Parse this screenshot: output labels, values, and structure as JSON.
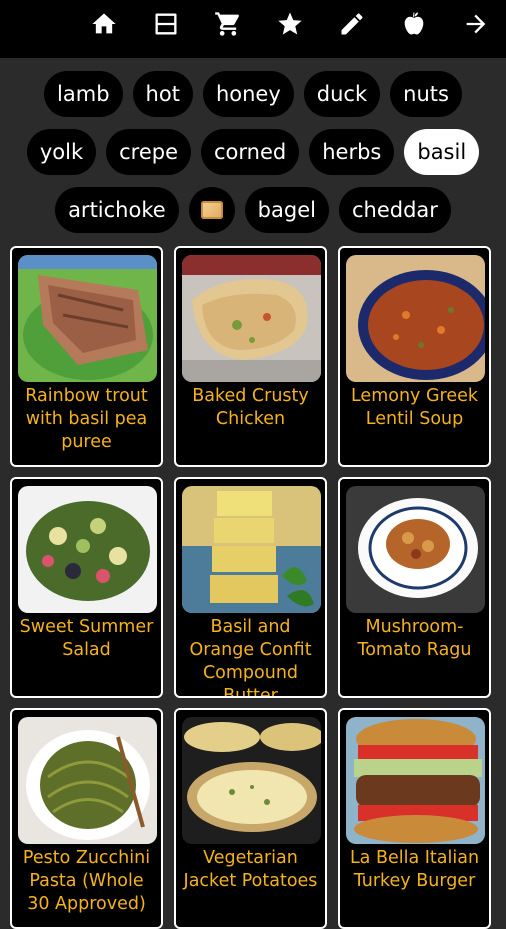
{
  "nav": {
    "icons": [
      "home-icon",
      "view-list-icon",
      "shopping-cart-icon",
      "star-icon",
      "pencil-icon",
      "apple-icon",
      "arrow-right-icon"
    ]
  },
  "filters": {
    "rows": [
      [
        "lamb",
        "hot",
        "honey",
        "duck",
        "nuts"
      ],
      [
        "yolk",
        "crepe",
        "corned",
        "herbs",
        "basil"
      ],
      [
        "artichoke",
        "",
        "bagel",
        "cheddar"
      ]
    ],
    "selected": "basil"
  },
  "recipes": [
    {
      "title": "Rainbow trout with basil pea puree"
    },
    {
      "title": "Baked Crusty Chicken"
    },
    {
      "title": "Lemony Greek Lentil Soup"
    },
    {
      "title": "Sweet Summer Salad"
    },
    {
      "title": "Basil and Orange Confit Compound Butter"
    },
    {
      "title": "Mushroom-Tomato Ragu"
    },
    {
      "title": "Pesto Zucchini Pasta (Whole 30 Approved)"
    },
    {
      "title": "Vegetarian Jacket Potatoes"
    },
    {
      "title": "La Bella Italian Turkey Burger"
    }
  ]
}
